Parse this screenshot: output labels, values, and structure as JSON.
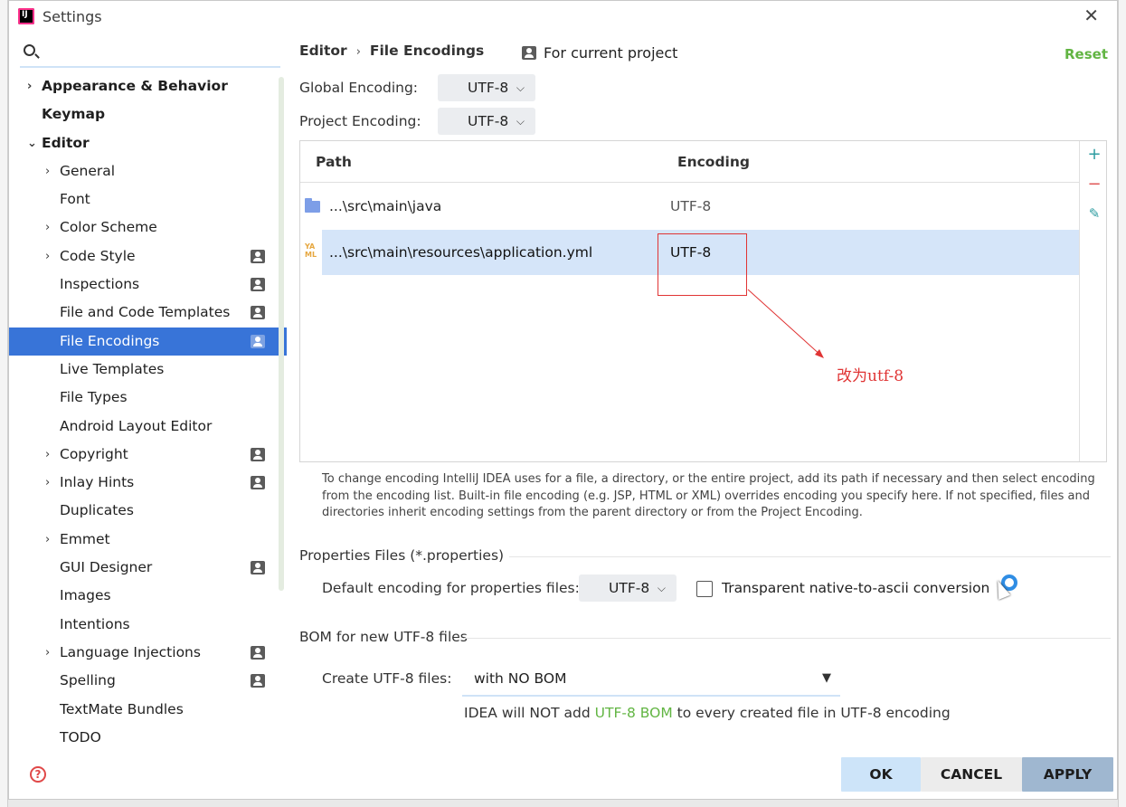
{
  "window": {
    "title": "Settings"
  },
  "search": {
    "placeholder": ""
  },
  "sidebar": {
    "items": [
      {
        "label": "Appearance & Behavior",
        "level": 0,
        "expander": "›",
        "bold": true,
        "project": false
      },
      {
        "label": "Keymap",
        "level": 0,
        "expander": "",
        "bold": true,
        "project": false
      },
      {
        "label": "Editor",
        "level": 0,
        "expander": "⌄",
        "bold": true,
        "project": false
      },
      {
        "label": "General",
        "level": 1,
        "expander": "›",
        "bold": false,
        "project": false
      },
      {
        "label": "Font",
        "level": 1,
        "expander": "",
        "bold": false,
        "project": false
      },
      {
        "label": "Color Scheme",
        "level": 1,
        "expander": "›",
        "bold": false,
        "project": false
      },
      {
        "label": "Code Style",
        "level": 1,
        "expander": "›",
        "bold": false,
        "project": true
      },
      {
        "label": "Inspections",
        "level": 1,
        "expander": "",
        "bold": false,
        "project": true
      },
      {
        "label": "File and Code Templates",
        "level": 1,
        "expander": "",
        "bold": false,
        "project": true
      },
      {
        "label": "File Encodings",
        "level": 1,
        "expander": "",
        "bold": false,
        "project": true,
        "selected": true
      },
      {
        "label": "Live Templates",
        "level": 1,
        "expander": "",
        "bold": false,
        "project": false
      },
      {
        "label": "File Types",
        "level": 1,
        "expander": "",
        "bold": false,
        "project": false
      },
      {
        "label": "Android Layout Editor",
        "level": 1,
        "expander": "",
        "bold": false,
        "project": false
      },
      {
        "label": "Copyright",
        "level": 1,
        "expander": "›",
        "bold": false,
        "project": true
      },
      {
        "label": "Inlay Hints",
        "level": 1,
        "expander": "›",
        "bold": false,
        "project": true
      },
      {
        "label": "Duplicates",
        "level": 1,
        "expander": "",
        "bold": false,
        "project": false
      },
      {
        "label": "Emmet",
        "level": 1,
        "expander": "›",
        "bold": false,
        "project": false
      },
      {
        "label": "GUI Designer",
        "level": 1,
        "expander": "",
        "bold": false,
        "project": true
      },
      {
        "label": "Images",
        "level": 1,
        "expander": "",
        "bold": false,
        "project": false
      },
      {
        "label": "Intentions",
        "level": 1,
        "expander": "",
        "bold": false,
        "project": false
      },
      {
        "label": "Language Injections",
        "level": 1,
        "expander": "›",
        "bold": false,
        "project": true
      },
      {
        "label": "Spelling",
        "level": 1,
        "expander": "",
        "bold": false,
        "project": true
      },
      {
        "label": "TextMate Bundles",
        "level": 1,
        "expander": "",
        "bold": false,
        "project": false
      },
      {
        "label": "TODO",
        "level": 1,
        "expander": "",
        "bold": false,
        "project": false
      }
    ]
  },
  "header": {
    "breadcrumb_root": "Editor",
    "breadcrumb_sep": "›",
    "breadcrumb_current": "File Encodings",
    "scope": "For current project",
    "reset": "Reset"
  },
  "encodings": {
    "global_label": "Global Encoding:",
    "global_value": "UTF-8",
    "project_label": "Project Encoding:",
    "project_value": "UTF-8"
  },
  "table": {
    "col_path": "Path",
    "col_encoding": "Encoding",
    "rows": [
      {
        "path": "...\\src\\main\\java",
        "encoding": "UTF-8",
        "icon": "folder-icon"
      },
      {
        "path": "...\\src\\main\\resources\\application.yml",
        "encoding": "UTF-8",
        "icon": "yaml-file-icon"
      }
    ],
    "yaml_icon_text": "YA ML"
  },
  "annotation": {
    "text": "改为utf-8",
    "color": "#e03434"
  },
  "help_text": "To change encoding IntelliJ IDEA uses for a file, a directory, or the entire project, add its path if necessary and then select encoding from the encoding list. Built-in file encoding (e.g. JSP, HTML or XML) overrides encoding you specify here. If not specified, files and directories inherit encoding settings from the parent directory or from the Project Encoding.",
  "properties": {
    "section_title": "Properties Files (*.properties)",
    "default_label": "Default encoding for properties files:",
    "default_value": "UTF-8",
    "transparent_label": "Transparent native-to-ascii conversion",
    "transparent_checked": false
  },
  "bom": {
    "section_title": "BOM for new UTF-8 files",
    "create_label": "Create UTF-8 files:",
    "create_value": "with NO BOM",
    "note_before": "IDEA will NOT add ",
    "note_highlight": "UTF-8 BOM",
    "note_after": " to every created file in UTF-8 encoding"
  },
  "buttons": {
    "ok": "OK",
    "cancel": "CANCEL",
    "apply": "APPLY"
  },
  "colors": {
    "accent": "#3874d8",
    "reset": "#62b543",
    "annotation": "#e03434"
  }
}
